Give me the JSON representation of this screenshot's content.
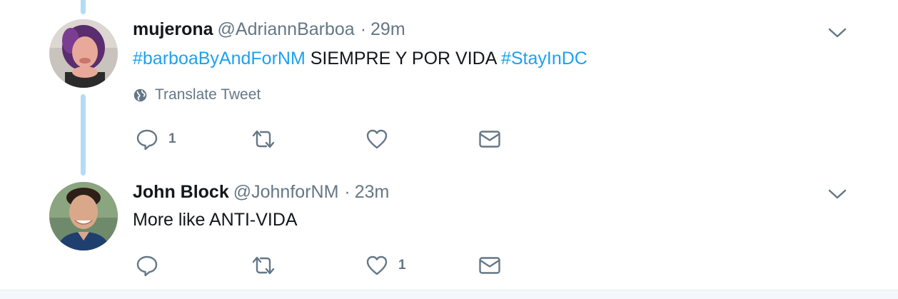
{
  "tweets": [
    {
      "name": "mujerona",
      "handle": "@AdriannBarboa",
      "separator": "·",
      "time": "29m",
      "hashtag1": "#barboaByAndForNM",
      "text_middle": " SIEMPRE Y POR VIDA ",
      "hashtag2": "#StayInDC",
      "translate_label": "Translate Tweet",
      "reply_count": "1",
      "like_count": ""
    },
    {
      "name": "John Block",
      "handle": "@JohnforNM",
      "separator": "·",
      "time": "23m",
      "text": "More like ANTI-VIDA",
      "reply_count": "",
      "like_count": "1"
    }
  ],
  "icons": {
    "reply": "reply-icon",
    "retweet": "retweet-icon",
    "like": "heart-icon",
    "dm": "envelope-icon",
    "more": "chevron-down-icon",
    "translate": "globe-icon"
  },
  "colors": {
    "hashtag": "#1da1f2",
    "secondary_text": "#657786",
    "thread_line": "#b3dcf7"
  }
}
